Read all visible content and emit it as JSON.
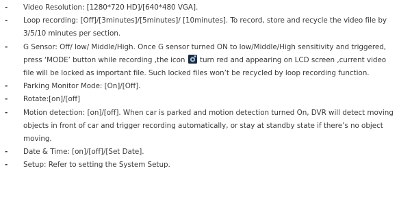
{
  "settings": [
    {
      "text": "Video Resolution: [1280*720 HD]/[640*480 VGA]."
    },
    {
      "text": "Loop recording: [Off]/[3minutes]/[5minutes]/ [10minutes]. To record, store and recycle the video file by 3/5/10 minutes per section."
    },
    {
      "text_before_icon": "G Sensor: Off/ low/ Middle/High. Once G sensor turned ON to low/Middle/High sensitivity and triggered, press ‘MODE’ button while recording ,the icon",
      "icon": "lock-record-icon",
      "text_after_icon": "turn red and appearing on LCD screen ,current video file will be locked as important file. Such locked files won’t be recycled by loop recording function."
    },
    {
      "text": "Parking Monitor Mode: [On]/[Off]."
    },
    {
      "text": "Rotate:[on]/[off]"
    },
    {
      "text": "Motion detection: [on]/[off]. When car is parked and motion detection turned On, DVR will detect moving objects in front of car and trigger recording automatically, or stay at standby state if there’s no object moving."
    },
    {
      "text": "Date & Time: [on]/[off]/[Set Date]."
    },
    {
      "text": "Setup: Refer to setting the System Setup."
    }
  ],
  "bullet": "-",
  "colors": {
    "text": "#3a3a3a",
    "icon_dark": "#1d2c3c",
    "icon_light": "#a9c6e6"
  }
}
